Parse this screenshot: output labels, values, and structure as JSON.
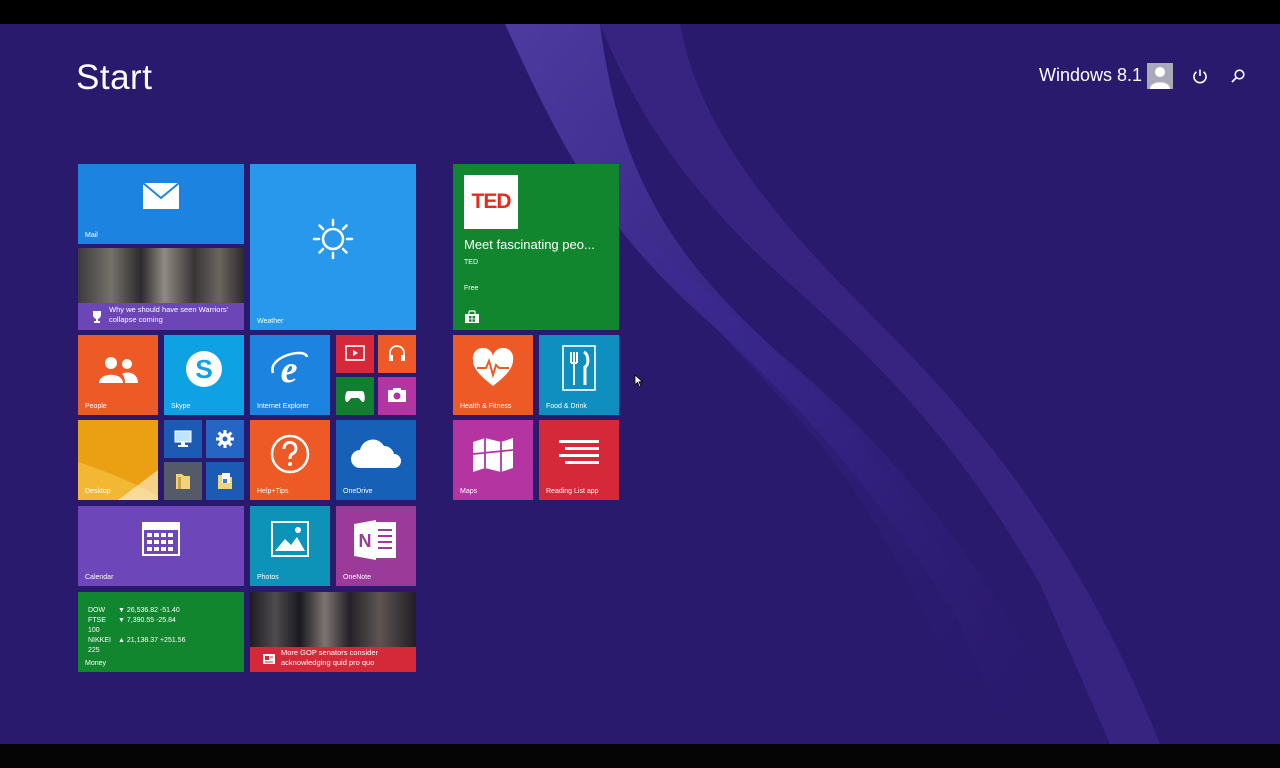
{
  "screen": {
    "title": "Start",
    "user": {
      "name": "Windows 8.1",
      "avatar_icon": "user-avatar-icon"
    },
    "power_icon": "power-icon",
    "search_icon": "search-icon"
  },
  "tiles": {
    "mail": {
      "label": "Mail",
      "icon": "envelope-icon"
    },
    "news_top": {
      "caption": "Why we should have seen Warriors' collapse coming",
      "icon": "trophy-icon"
    },
    "weather": {
      "label": "Weather",
      "icon": "sun-icon"
    },
    "ted": {
      "logo": "TED",
      "headline": "Meet fascinating peo...",
      "publisher": "TED",
      "price": "Free",
      "icon": "store-bag-icon"
    },
    "people": {
      "label": "People",
      "icon": "people-icon"
    },
    "skype": {
      "label": "Skype",
      "icon": "skype-icon"
    },
    "internet_explorer": {
      "label": "Internet Explorer",
      "icon": "ie-icon"
    },
    "video": {
      "icon": "video-icon"
    },
    "music": {
      "icon": "headphones-icon"
    },
    "games": {
      "icon": "game-controller-icon"
    },
    "camera": {
      "icon": "camera-icon"
    },
    "health": {
      "label": "Health & Fitness",
      "icon": "heart-icon"
    },
    "food": {
      "label": "Food & Drink",
      "icon": "fork-knife-icon"
    },
    "desktop": {
      "label": "Desktop"
    },
    "this_pc": {
      "icon": "computer-icon"
    },
    "pc_settings": {
      "icon": "gear-icon"
    },
    "file_explorer": {
      "icon": "folder-icon"
    },
    "documents": {
      "icon": "document-folder-icon"
    },
    "help": {
      "label": "Help+Tips",
      "icon": "question-icon"
    },
    "onedrive": {
      "label": "OneDrive",
      "icon": "cloud-icon"
    },
    "maps": {
      "label": "Maps",
      "icon": "map-icon"
    },
    "reading_list": {
      "label": "Reading List app",
      "icon": "reading-list-icon"
    },
    "calendar": {
      "label": "Calendar",
      "icon": "calendar-icon"
    },
    "photos": {
      "label": "Photos",
      "icon": "picture-icon"
    },
    "onenote": {
      "label": "OneNote",
      "icon": "onenote-icon"
    },
    "money": {
      "label": "Money",
      "rows": [
        {
          "index": "DOW",
          "value": "▼ 26,536.82 -51.40"
        },
        {
          "index": "FTSE 100",
          "value": "▼ 7,390.55 -25.84"
        },
        {
          "index": "NIKKEI 225",
          "value": "▲ 21,138.37 +251.56"
        }
      ]
    },
    "news_bottom": {
      "caption": "More GOP senators consider acknowledging quid pro quo",
      "icon": "news-icon"
    }
  },
  "colors": {
    "background": "#2a1a6e",
    "mail": "#1c84e0",
    "weather": "#2798ec",
    "ted": "#11862f",
    "people": "#ee5a26",
    "skype": "#0ea1e4",
    "maps": "#b434a2",
    "reading_list": "#d5293a",
    "calendar": "#6d46b9"
  }
}
